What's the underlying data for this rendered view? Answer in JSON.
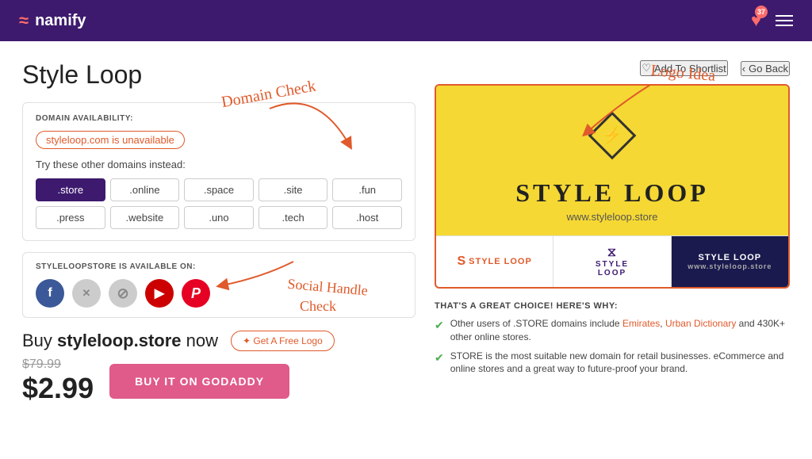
{
  "header": {
    "logo_text": "namify",
    "logo_icon": "≈",
    "heart_count": "37",
    "hamburger_label": "menu"
  },
  "page": {
    "title": "Style Loop"
  },
  "domain": {
    "section_label": "DOMAIN AVAILABILITY:",
    "unavailable_text": "styleloop.com is unavailable",
    "try_other_text": "Try these other domains instead:",
    "options": [
      {
        "label": ".store",
        "active": true
      },
      {
        "label": ".online",
        "active": false
      },
      {
        "label": ".space",
        "active": false
      },
      {
        "label": ".site",
        "active": false
      },
      {
        "label": ".fun",
        "active": false
      },
      {
        "label": ".press",
        "active": false
      },
      {
        "label": ".website",
        "active": false
      },
      {
        "label": ".uno",
        "active": false
      },
      {
        "label": ".tech",
        "active": false
      },
      {
        "label": ".host",
        "active": false
      }
    ]
  },
  "social": {
    "section_label": "STYLELOOPSTORE IS AVAILABLE ON:",
    "icons": [
      {
        "name": "facebook",
        "symbol": "f",
        "class": "si-fb"
      },
      {
        "name": "twitter",
        "symbol": "𝕏",
        "class": "si-tw"
      },
      {
        "name": "instagram",
        "symbol": "⊘",
        "class": "si-ig"
      },
      {
        "name": "youtube",
        "symbol": "▶",
        "class": "si-yt"
      },
      {
        "name": "pinterest",
        "symbol": "𝒫",
        "class": "si-pt"
      }
    ]
  },
  "buy": {
    "text": "Buy ",
    "domain_name": "styleloop.store",
    "text_end": " now",
    "free_logo_label": "✦ Get A Free Logo",
    "old_price": "$79.99",
    "new_price": "$2.99",
    "cta_label": "BUY IT ON GODADDY"
  },
  "logo_preview": {
    "brand_name": "STYLE LOOP",
    "url": "www.styleloop.store",
    "diamond_symbol": "⚡",
    "variant1_text": "STYLE LOOP",
    "variant2_text": "STYLE\nLOOP",
    "variant3_text": "STYLE LOOP"
  },
  "right_header": {
    "shortlist_label": "Add To Shortlist",
    "go_back_label": "Go Back"
  },
  "why": {
    "title": "THAT'S A GREAT CHOICE! HERE'S WHY:",
    "items": [
      {
        "text_before": "Other users of .STORE domains include ",
        "links": [
          "Emirates",
          "Urban Dictionary"
        ],
        "text_after": " and 430K+ other online stores."
      },
      {
        "text_before": "STORE is the most suitable new domain for retail businesses. eCommerce and online stores and a great way to future-proof your brand.",
        "links": [],
        "text_after": ""
      }
    ]
  },
  "annotations": {
    "domain_check": "Domain Check",
    "logo_idea": "Logo Idea",
    "social_handle": "Social Handle\nCheck"
  }
}
